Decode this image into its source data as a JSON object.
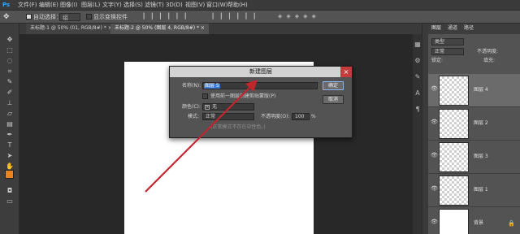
{
  "app_logo": "Ps",
  "menu": [
    "文件(F)",
    "编辑(E)",
    "图像(I)",
    "图层(L)",
    "文字(Y)",
    "选择(S)",
    "滤镜(T)",
    "3D(D)",
    "视图(V)",
    "窗口(W)",
    "帮助(H)"
  ],
  "options": {
    "auto_select_label": "自动选择：",
    "auto_select_value": "组",
    "show_transform_label": "显示变换控件"
  },
  "tabs": [
    {
      "label": "未标题-1 @ 50% (01, RGB/8#) *",
      "close": "×"
    },
    {
      "label": "未标题-2 @ 50% (图层 4, RGB/8#) *",
      "close": "×"
    }
  ],
  "dialog": {
    "title": "新建图层",
    "name_label": "名称(N):",
    "name_value": "图层 5",
    "clip_label": "使用前一图层创建剪贴蒙版(P)",
    "color_label": "颜色(C):",
    "color_value": "无",
    "mode_label": "模式:",
    "mode_value": "正常",
    "opacity_label": "不透明度(O):",
    "opacity_value": "100",
    "opacity_unit": "%",
    "hint": "(正常模式不存在中性色。)",
    "ok_label": "确定",
    "cancel_label": "取消",
    "close_glyph": "×"
  },
  "panel": {
    "tabs": [
      "图层",
      "通道",
      "路径"
    ],
    "filter_label": "类型",
    "blend_mode": "正常",
    "opacity_label": "不透明度:",
    "lock_label": "锁定:",
    "fill_label": "填充:",
    "layers": [
      {
        "name": "图层 4",
        "selected": true,
        "background": false
      },
      {
        "name": "图层 2",
        "selected": false,
        "background": false
      },
      {
        "name": "图层 3",
        "selected": false,
        "background": false
      },
      {
        "name": "图层 1",
        "selected": false,
        "background": false
      },
      {
        "name": "背景",
        "selected": false,
        "background": true
      }
    ]
  },
  "colors": {
    "foreground": "#e8821e",
    "background": "#ffffff",
    "arrow": "#c0272d",
    "highlight": "#3a7bd5"
  }
}
